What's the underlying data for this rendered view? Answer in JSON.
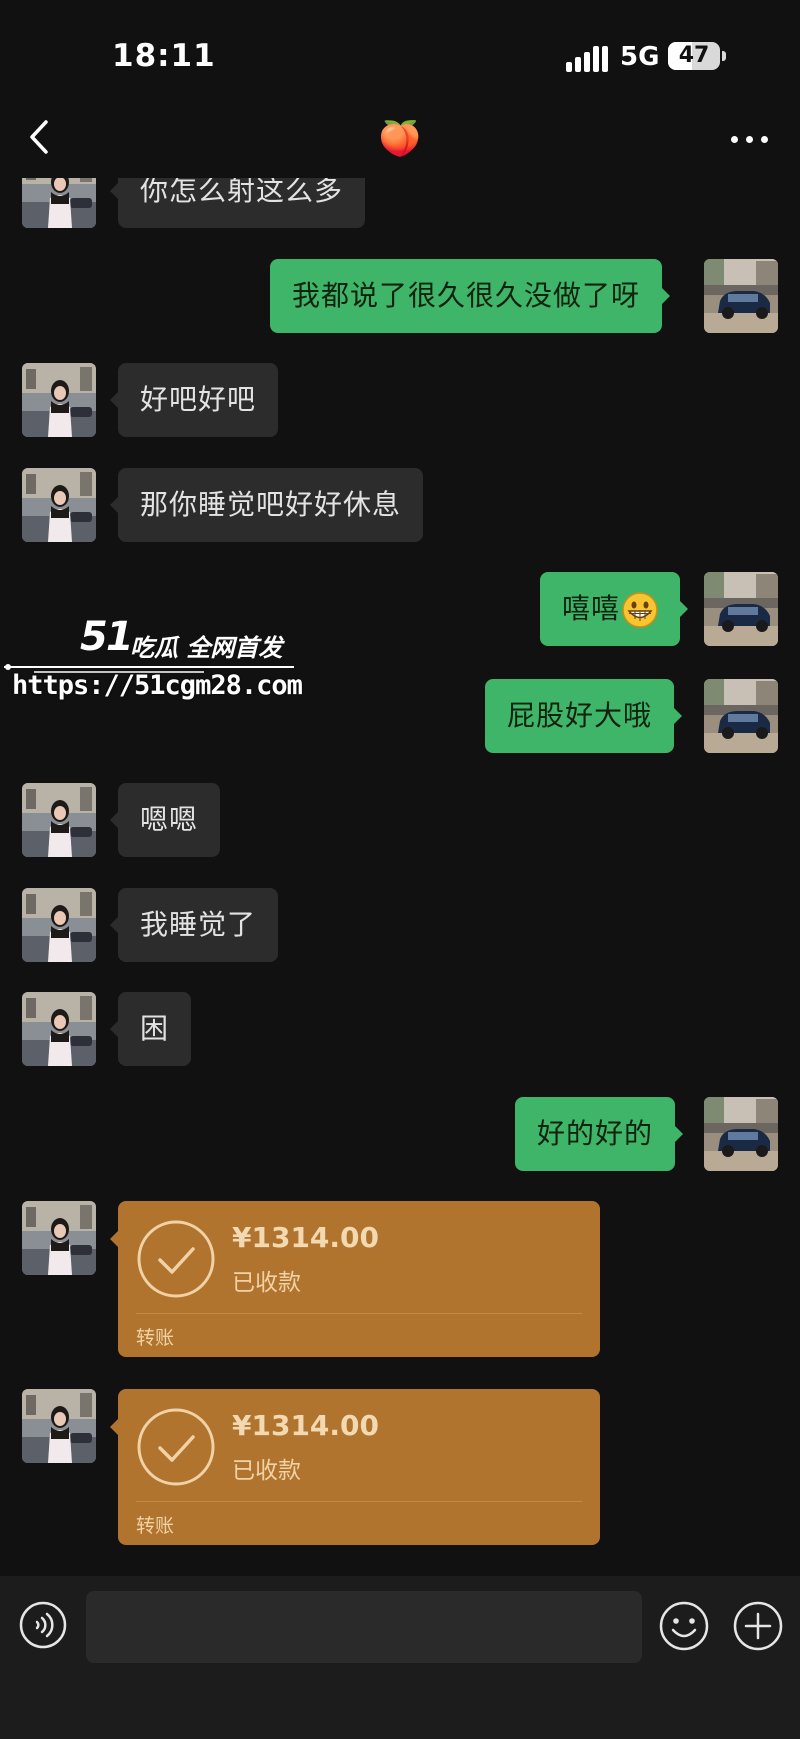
{
  "status_bar": {
    "time": "18:11",
    "network": "5G",
    "battery": "47",
    "battery_level": 0.47
  },
  "header": {
    "title": "🍑",
    "back_icon": "chevron-left-icon",
    "more_icon": "more-dots-icon"
  },
  "messages": [
    {
      "side": "in",
      "text": "你怎么射这么多"
    },
    {
      "side": "out",
      "text": "我都说了很久很久没做了呀"
    },
    {
      "side": "in",
      "text": "好吧好吧"
    },
    {
      "side": "in",
      "text": "那你睡觉吧好好休息"
    },
    {
      "side": "out",
      "text": "嘻嘻",
      "emoji": "grinning-face-icon"
    },
    {
      "side": "out",
      "text": "屁股好大哦"
    },
    {
      "side": "in",
      "text": "嗯嗯"
    },
    {
      "side": "in",
      "text": "我睡觉了"
    },
    {
      "side": "in",
      "text": "困"
    },
    {
      "side": "out",
      "text": "好的好的"
    }
  ],
  "transfers": [
    {
      "amount": "¥1314.00",
      "status": "已收款",
      "label": "转账"
    },
    {
      "amount": "¥1314.00",
      "status": "已收款",
      "label": "转账"
    }
  ],
  "watermark": {
    "logo": "51",
    "slogan": "吃瓜 全网首发",
    "url": "https://51cgm28.com"
  },
  "input_bar": {
    "placeholder": "",
    "voice_icon": "voice-icon",
    "emoji_icon": "emoji-icon",
    "plus_icon": "plus-icon"
  },
  "colors": {
    "outgoing_bubble": "#3fb56a",
    "incoming_bubble": "#2c2c2c",
    "transfer_card": "#b0742e",
    "background": "#111111"
  }
}
